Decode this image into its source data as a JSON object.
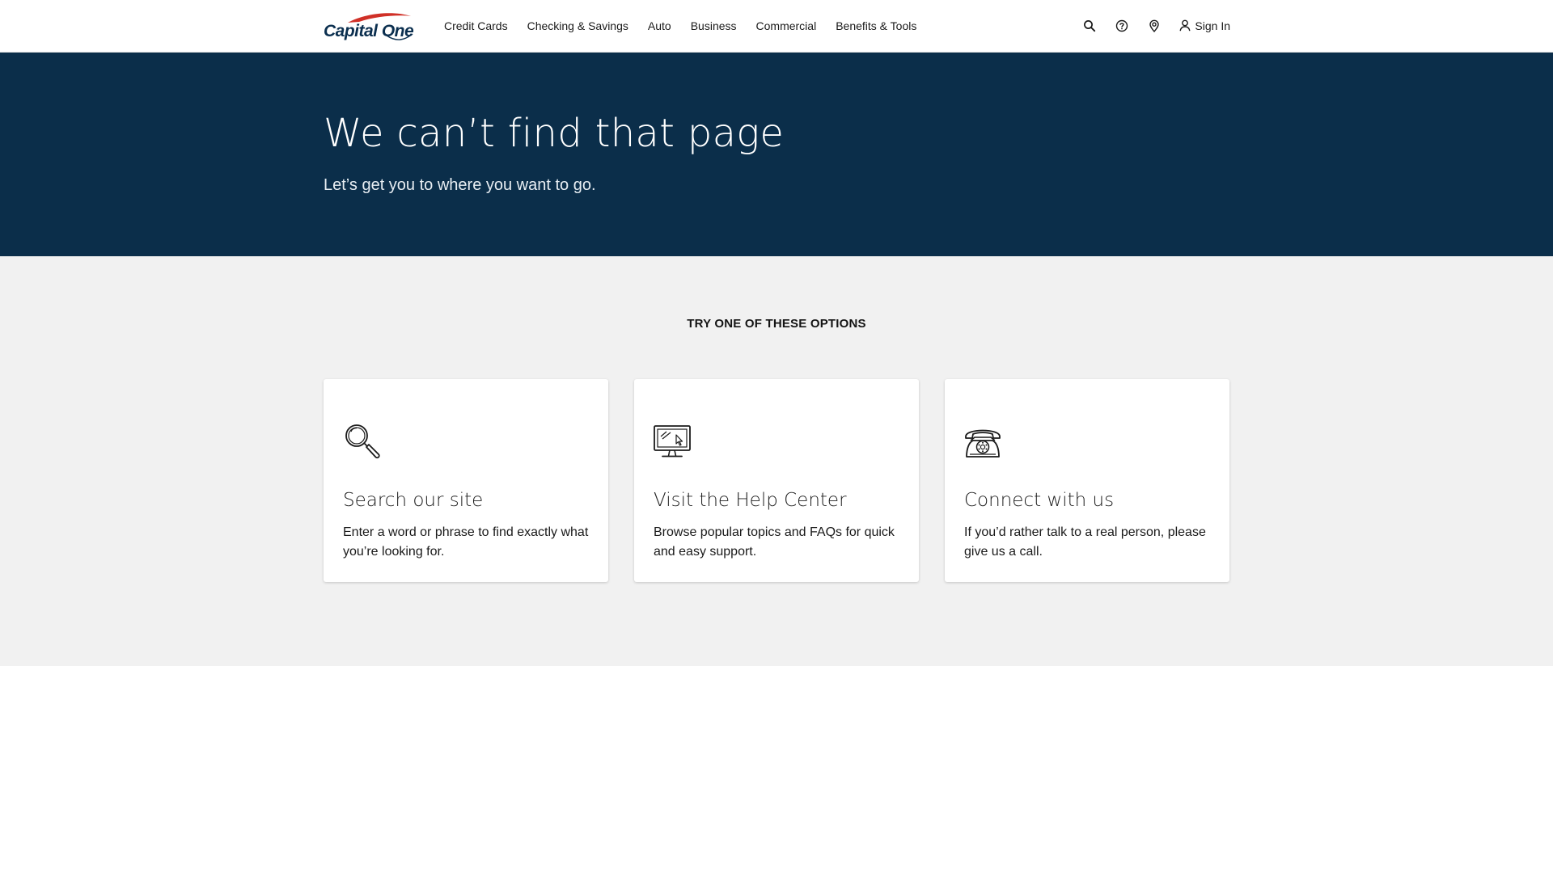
{
  "brand": {
    "name": "Capital One",
    "primary_color": "#0b2f4f",
    "accent_color": "#d03027"
  },
  "nav": {
    "items": [
      {
        "label": "Credit Cards"
      },
      {
        "label": "Checking & Savings"
      },
      {
        "label": "Auto"
      },
      {
        "label": "Business"
      },
      {
        "label": "Commercial"
      },
      {
        "label": "Benefits & Tools"
      }
    ]
  },
  "header_tools": {
    "icons": [
      "search-icon",
      "help-icon",
      "location-icon",
      "user-icon"
    ],
    "sign_in_label": "Sign In"
  },
  "hero": {
    "title": "We can’t find that page",
    "subtitle": "Let’s get you to where you want to go.",
    "background_color": "#0b2e4a"
  },
  "options": {
    "heading": "TRY ONE OF THESE OPTIONS",
    "cards": [
      {
        "icon": "magnifier-icon",
        "title": "Search our site",
        "description": "Enter a word or phrase to find exactly what you’re looking for."
      },
      {
        "icon": "monitor-icon",
        "title": "Visit the Help Center",
        "description": "Browse popular topics and FAQs for quick and easy support."
      },
      {
        "icon": "telephone-icon",
        "title": "Connect with us",
        "description": "If you’d rather talk to a real person, please give us a call."
      }
    ]
  }
}
